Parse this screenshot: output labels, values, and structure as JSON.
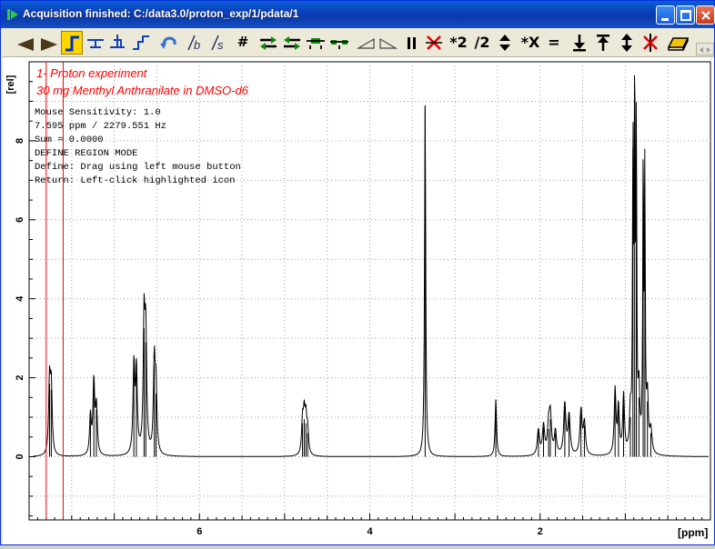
{
  "window": {
    "title": "Acquisition finished: C:/data3.0/proton_exp/1/pdata/1"
  },
  "toolbar": {
    "buttons": [
      {
        "name": "shift-left-button",
        "icon": "arrow-left-icon"
      },
      {
        "name": "shift-right-button",
        "icon": "arrow-right-icon"
      },
      {
        "name": "phase-correction-button",
        "icon": "phase-icon",
        "active": true
      },
      {
        "name": "baseline-button",
        "icon": "baseline-icon"
      },
      {
        "name": "peak-pick-button",
        "icon": "peak-pick-icon"
      },
      {
        "name": "integrate-button",
        "icon": "integrate-icon"
      },
      {
        "name": "undo-button",
        "icon": "undo-icon"
      },
      {
        "name": "integral-b-button",
        "icon": "integral-b-icon"
      },
      {
        "name": "integral-s-button",
        "icon": "integral-s-icon"
      },
      {
        "name": "grid-button",
        "icon": "hash-icon",
        "label": "#"
      },
      {
        "name": "compress-x-button",
        "icon": "compress-x-icon"
      },
      {
        "name": "expand-x-button",
        "icon": "expand-x-icon"
      },
      {
        "name": "zoom-in-x-button",
        "icon": "zoom-in-x-icon"
      },
      {
        "name": "zoom-out-x-button",
        "icon": "zoom-out-x-icon"
      },
      {
        "name": "triangle-left-button",
        "icon": "triangle-left-icon"
      },
      {
        "name": "triangle-right-button",
        "icon": "triangle-right-icon"
      },
      {
        "name": "pause-button",
        "icon": "pause-icon"
      },
      {
        "name": "cross-red-button",
        "icon": "cross-red-icon"
      },
      {
        "name": "scale-up-button",
        "icon": "times-2-icon",
        "label": "*2"
      },
      {
        "name": "scale-down-button",
        "icon": "divide-2-icon",
        "label": "/2"
      },
      {
        "name": "scale-updown-button",
        "icon": "up-down-arrows-icon"
      },
      {
        "name": "scale-x-button",
        "icon": "times-x-icon",
        "label": "*X"
      },
      {
        "name": "equal-button",
        "icon": "equal-icon",
        "label": "="
      },
      {
        "name": "move-down-button",
        "icon": "arrow-bottom-icon"
      },
      {
        "name": "move-up-button",
        "icon": "arrow-top-icon"
      },
      {
        "name": "move-updown-button",
        "icon": "double-arrow-icon"
      },
      {
        "name": "cancel-region-button",
        "icon": "cancel-region-icon"
      },
      {
        "name": "eraser-button",
        "icon": "eraser-icon"
      }
    ]
  },
  "spectrum": {
    "title_line1": "1- Proton experiment",
    "title_line2": "30 mg Menthyl Anthranilate in DMSO-d6",
    "info_lines": [
      "Mouse Sensitivity: 1.0",
      "7.595 ppm / 2279.551 Hz",
      "Sum = 0.0000",
      "DEFINE REGION MODE",
      "Define: Drag using left mouse button",
      "Return: Left-click highlighted icon"
    ],
    "y_unit_label": "[rel]",
    "x_unit_label": "[ppm]",
    "annotation_color": "#ff0000",
    "region_lines_ppm": [
      7.8,
      7.6
    ]
  },
  "chart_data": {
    "type": "line",
    "x_axis": {
      "label": "[ppm]",
      "range": [
        8.0,
        0.0
      ],
      "ticks": [
        6,
        4,
        2
      ],
      "reversed": true
    },
    "y_axis": {
      "label": "[rel]",
      "range": [
        -1.6,
        10.0
      ],
      "ticks": [
        0,
        2,
        4,
        6,
        8
      ]
    },
    "grid": true,
    "peaks": [
      {
        "ppm": 7.76,
        "height": 1.85,
        "width": 0.012
      },
      {
        "ppm": 7.74,
        "height": 1.7,
        "width": 0.012
      },
      {
        "ppm": 7.28,
        "height": 1.0,
        "width": 0.012
      },
      {
        "ppm": 7.24,
        "height": 1.85,
        "width": 0.012
      },
      {
        "ppm": 7.21,
        "height": 1.2,
        "width": 0.012
      },
      {
        "ppm": 6.77,
        "height": 2.25,
        "width": 0.012
      },
      {
        "ppm": 6.74,
        "height": 2.1,
        "width": 0.012
      },
      {
        "ppm": 6.65,
        "height": 3.25,
        "width": 0.012
      },
      {
        "ppm": 6.63,
        "height": 2.9,
        "width": 0.012
      },
      {
        "ppm": 6.53,
        "height": 2.3,
        "width": 0.012
      },
      {
        "ppm": 6.51,
        "height": 1.6,
        "width": 0.012
      },
      {
        "ppm": 4.79,
        "height": 0.85,
        "width": 0.012
      },
      {
        "ppm": 4.77,
        "height": 0.95,
        "width": 0.012
      },
      {
        "ppm": 4.75,
        "height": 0.85,
        "width": 0.012
      },
      {
        "ppm": 4.73,
        "height": 0.6,
        "width": 0.012
      },
      {
        "ppm": 3.35,
        "height": 8.9,
        "width": 0.008
      },
      {
        "ppm": 2.52,
        "height": 1.45,
        "width": 0.01
      },
      {
        "ppm": 2.02,
        "height": 0.65,
        "width": 0.015
      },
      {
        "ppm": 1.96,
        "height": 0.75,
        "width": 0.015
      },
      {
        "ppm": 1.9,
        "height": 0.7,
        "width": 0.015
      },
      {
        "ppm": 1.88,
        "height": 0.95,
        "width": 0.015
      },
      {
        "ppm": 1.82,
        "height": 0.6,
        "width": 0.015
      },
      {
        "ppm": 1.71,
        "height": 1.3,
        "width": 0.015
      },
      {
        "ppm": 1.66,
        "height": 1.0,
        "width": 0.015
      },
      {
        "ppm": 1.52,
        "height": 1.15,
        "width": 0.015
      },
      {
        "ppm": 1.48,
        "height": 0.8,
        "width": 0.015
      },
      {
        "ppm": 1.12,
        "height": 1.65,
        "width": 0.012
      },
      {
        "ppm": 1.08,
        "height": 1.2,
        "width": 0.012
      },
      {
        "ppm": 1.02,
        "height": 1.5,
        "width": 0.012
      },
      {
        "ppm": 0.94,
        "height": 1.0,
        "width": 0.012
      },
      {
        "ppm": 0.91,
        "height": 7.8,
        "width": 0.006
      },
      {
        "ppm": 0.89,
        "height": 9.3,
        "width": 0.006
      },
      {
        "ppm": 0.87,
        "height": 7.9,
        "width": 0.006
      },
      {
        "ppm": 0.84,
        "height": 1.5,
        "width": 0.012
      },
      {
        "ppm": 0.79,
        "height": 7.4,
        "width": 0.006
      },
      {
        "ppm": 0.77,
        "height": 6.9,
        "width": 0.006
      },
      {
        "ppm": 0.74,
        "height": 1.4,
        "width": 0.012
      },
      {
        "ppm": 0.7,
        "height": 0.6,
        "width": 0.015
      }
    ]
  }
}
